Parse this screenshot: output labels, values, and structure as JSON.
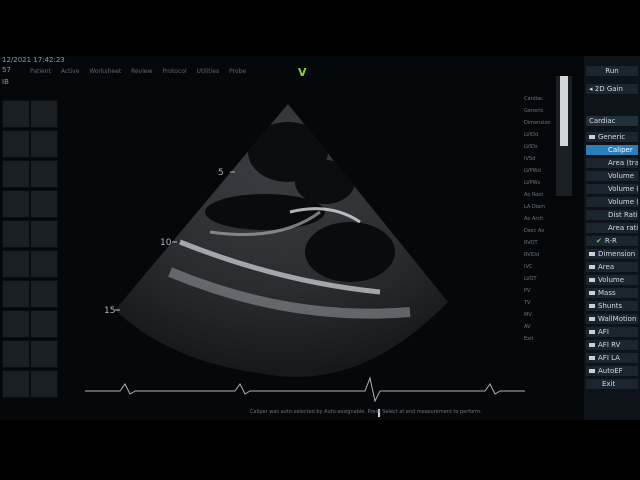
{
  "header": {
    "timestamp": "12/2021 17:42:23",
    "line1": "57",
    "line2": "IB",
    "toolbar": [
      "Patient",
      "Active",
      "Worksheet",
      "Review",
      "Protocol",
      "Utilities",
      "Probe"
    ]
  },
  "image": {
    "depth_labels": [
      "5",
      "10",
      "15"
    ],
    "marker": "V"
  },
  "right_panel": {
    "run_label": "Run",
    "gain_label": "2D Gain",
    "items": [
      {
        "label": "Cardiac",
        "kind": "header"
      },
      {
        "label": "Generic",
        "kind": "folder-open"
      },
      {
        "label": "Caliper",
        "kind": "selected"
      },
      {
        "label": "Area (trace)",
        "kind": "item"
      },
      {
        "label": "Volume",
        "kind": "item"
      },
      {
        "label": "Volume (A-L)",
        "kind": "item"
      },
      {
        "label": "Volume (Simpson)",
        "kind": "item"
      },
      {
        "label": "Dist Ratio",
        "kind": "item"
      },
      {
        "label": "Area ratio",
        "kind": "item"
      },
      {
        "label": "R-R",
        "kind": "checked"
      },
      {
        "label": "Dimension",
        "kind": "folder"
      },
      {
        "label": "Area",
        "kind": "folder"
      },
      {
        "label": "Volume",
        "kind": "folder"
      },
      {
        "label": "Mass",
        "kind": "folder"
      },
      {
        "label": "Shunts",
        "kind": "folder"
      },
      {
        "label": "WallMotion",
        "kind": "folder"
      },
      {
        "label": "AFI",
        "kind": "folder"
      },
      {
        "label": "AFI RV",
        "kind": "folder"
      },
      {
        "label": "AFI LA",
        "kind": "folder"
      },
      {
        "label": "AutoEF",
        "kind": "folder"
      },
      {
        "label": "Exit",
        "kind": "item"
      }
    ]
  },
  "middle_menu": [
    "Cardiac",
    "Generic",
    "Dimension",
    "LVIDd",
    "LVIDs",
    "IVSd",
    "LVPWd",
    "LVPWs",
    "Ao Root",
    "LA Diam",
    "Ao Arch",
    "Desc Ao",
    "RVOT",
    "RVIDd",
    "IVC",
    "LVOT",
    "PV",
    "TV",
    "MV",
    "AV",
    "Exit"
  ],
  "status": "Caliper was auto-selected by Auto-assignable. Press Select at end measurement to perform."
}
